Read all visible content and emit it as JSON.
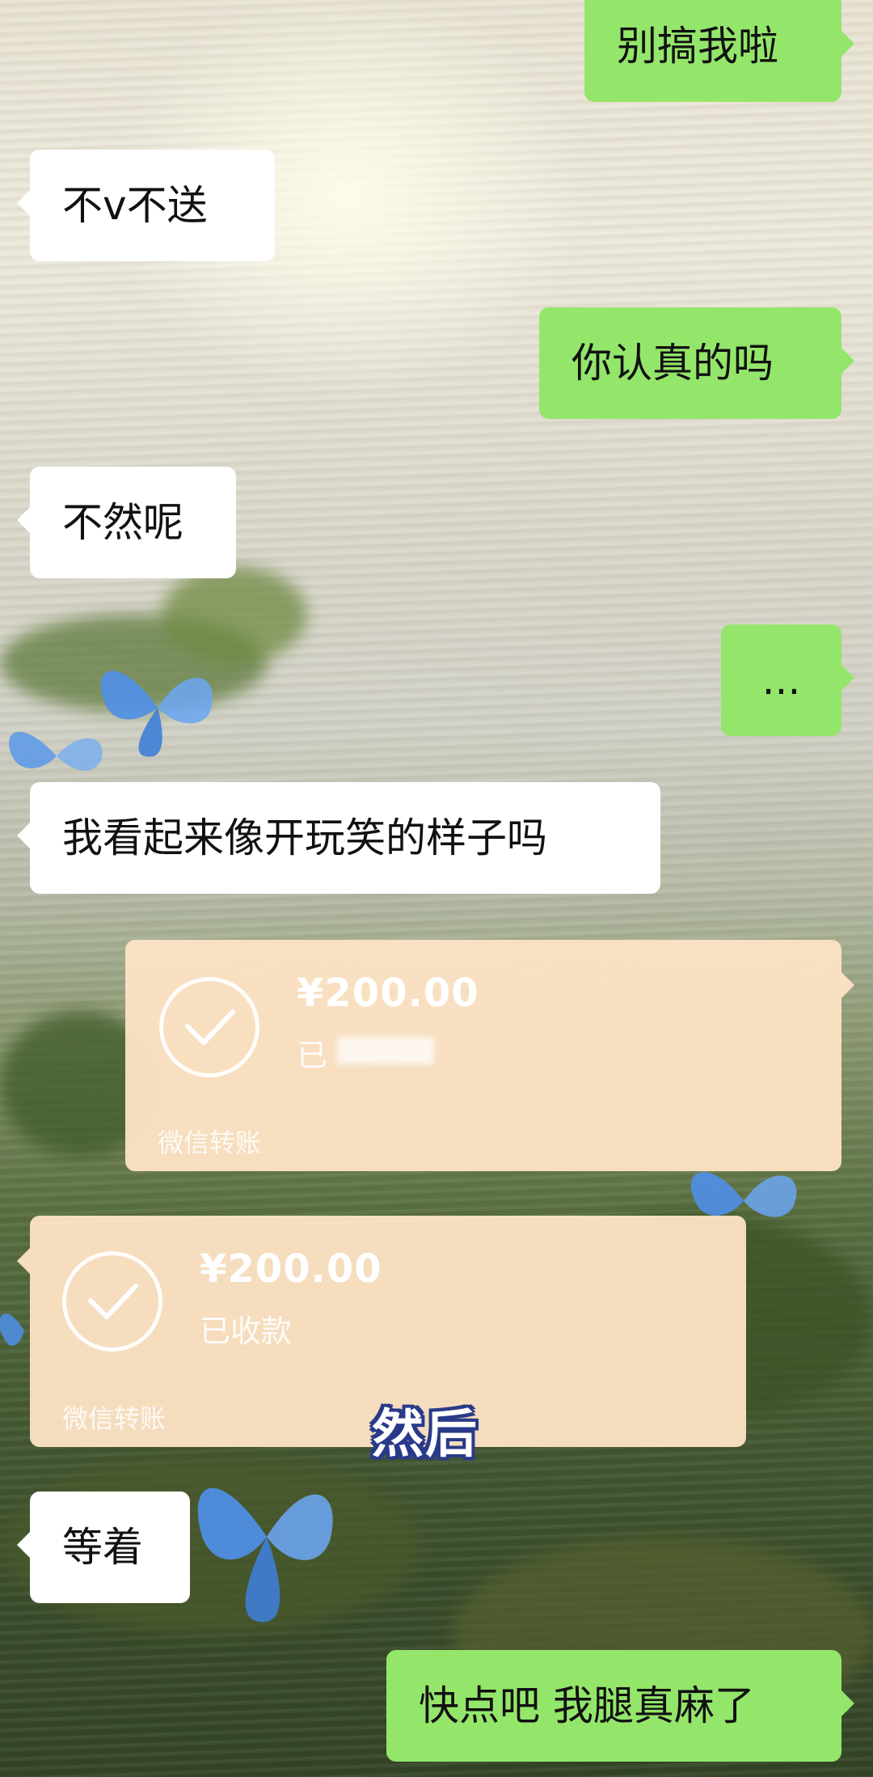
{
  "chat": {
    "messages": [
      {
        "side": "right",
        "text": "别搞我啦"
      },
      {
        "side": "left",
        "text": "不v不送"
      },
      {
        "side": "right",
        "text": "你认真的吗"
      },
      {
        "side": "left",
        "text": "不然呢"
      },
      {
        "side": "right",
        "text": "..."
      },
      {
        "side": "left",
        "text": "我看起来像开玩笑的样子吗"
      },
      {
        "side": "left",
        "text": "等着"
      },
      {
        "side": "right",
        "text": "快点吧 我腿真麻了"
      }
    ],
    "transfers": [
      {
        "side": "right",
        "amount": "¥200.00",
        "status": "已",
        "footer": "微信转账"
      },
      {
        "side": "left",
        "amount": "¥200.00",
        "status": "已收款",
        "footer": "微信转账"
      }
    ]
  },
  "overlay": {
    "caption": "然后"
  },
  "colors": {
    "sent_bubble": "#94e66b",
    "received_bubble": "#ffffff",
    "transfer_card": "#fce2c4",
    "caption_outline": "#2a3a8a"
  },
  "icons": [
    "check-circle-icon",
    "butterfly-icon"
  ]
}
